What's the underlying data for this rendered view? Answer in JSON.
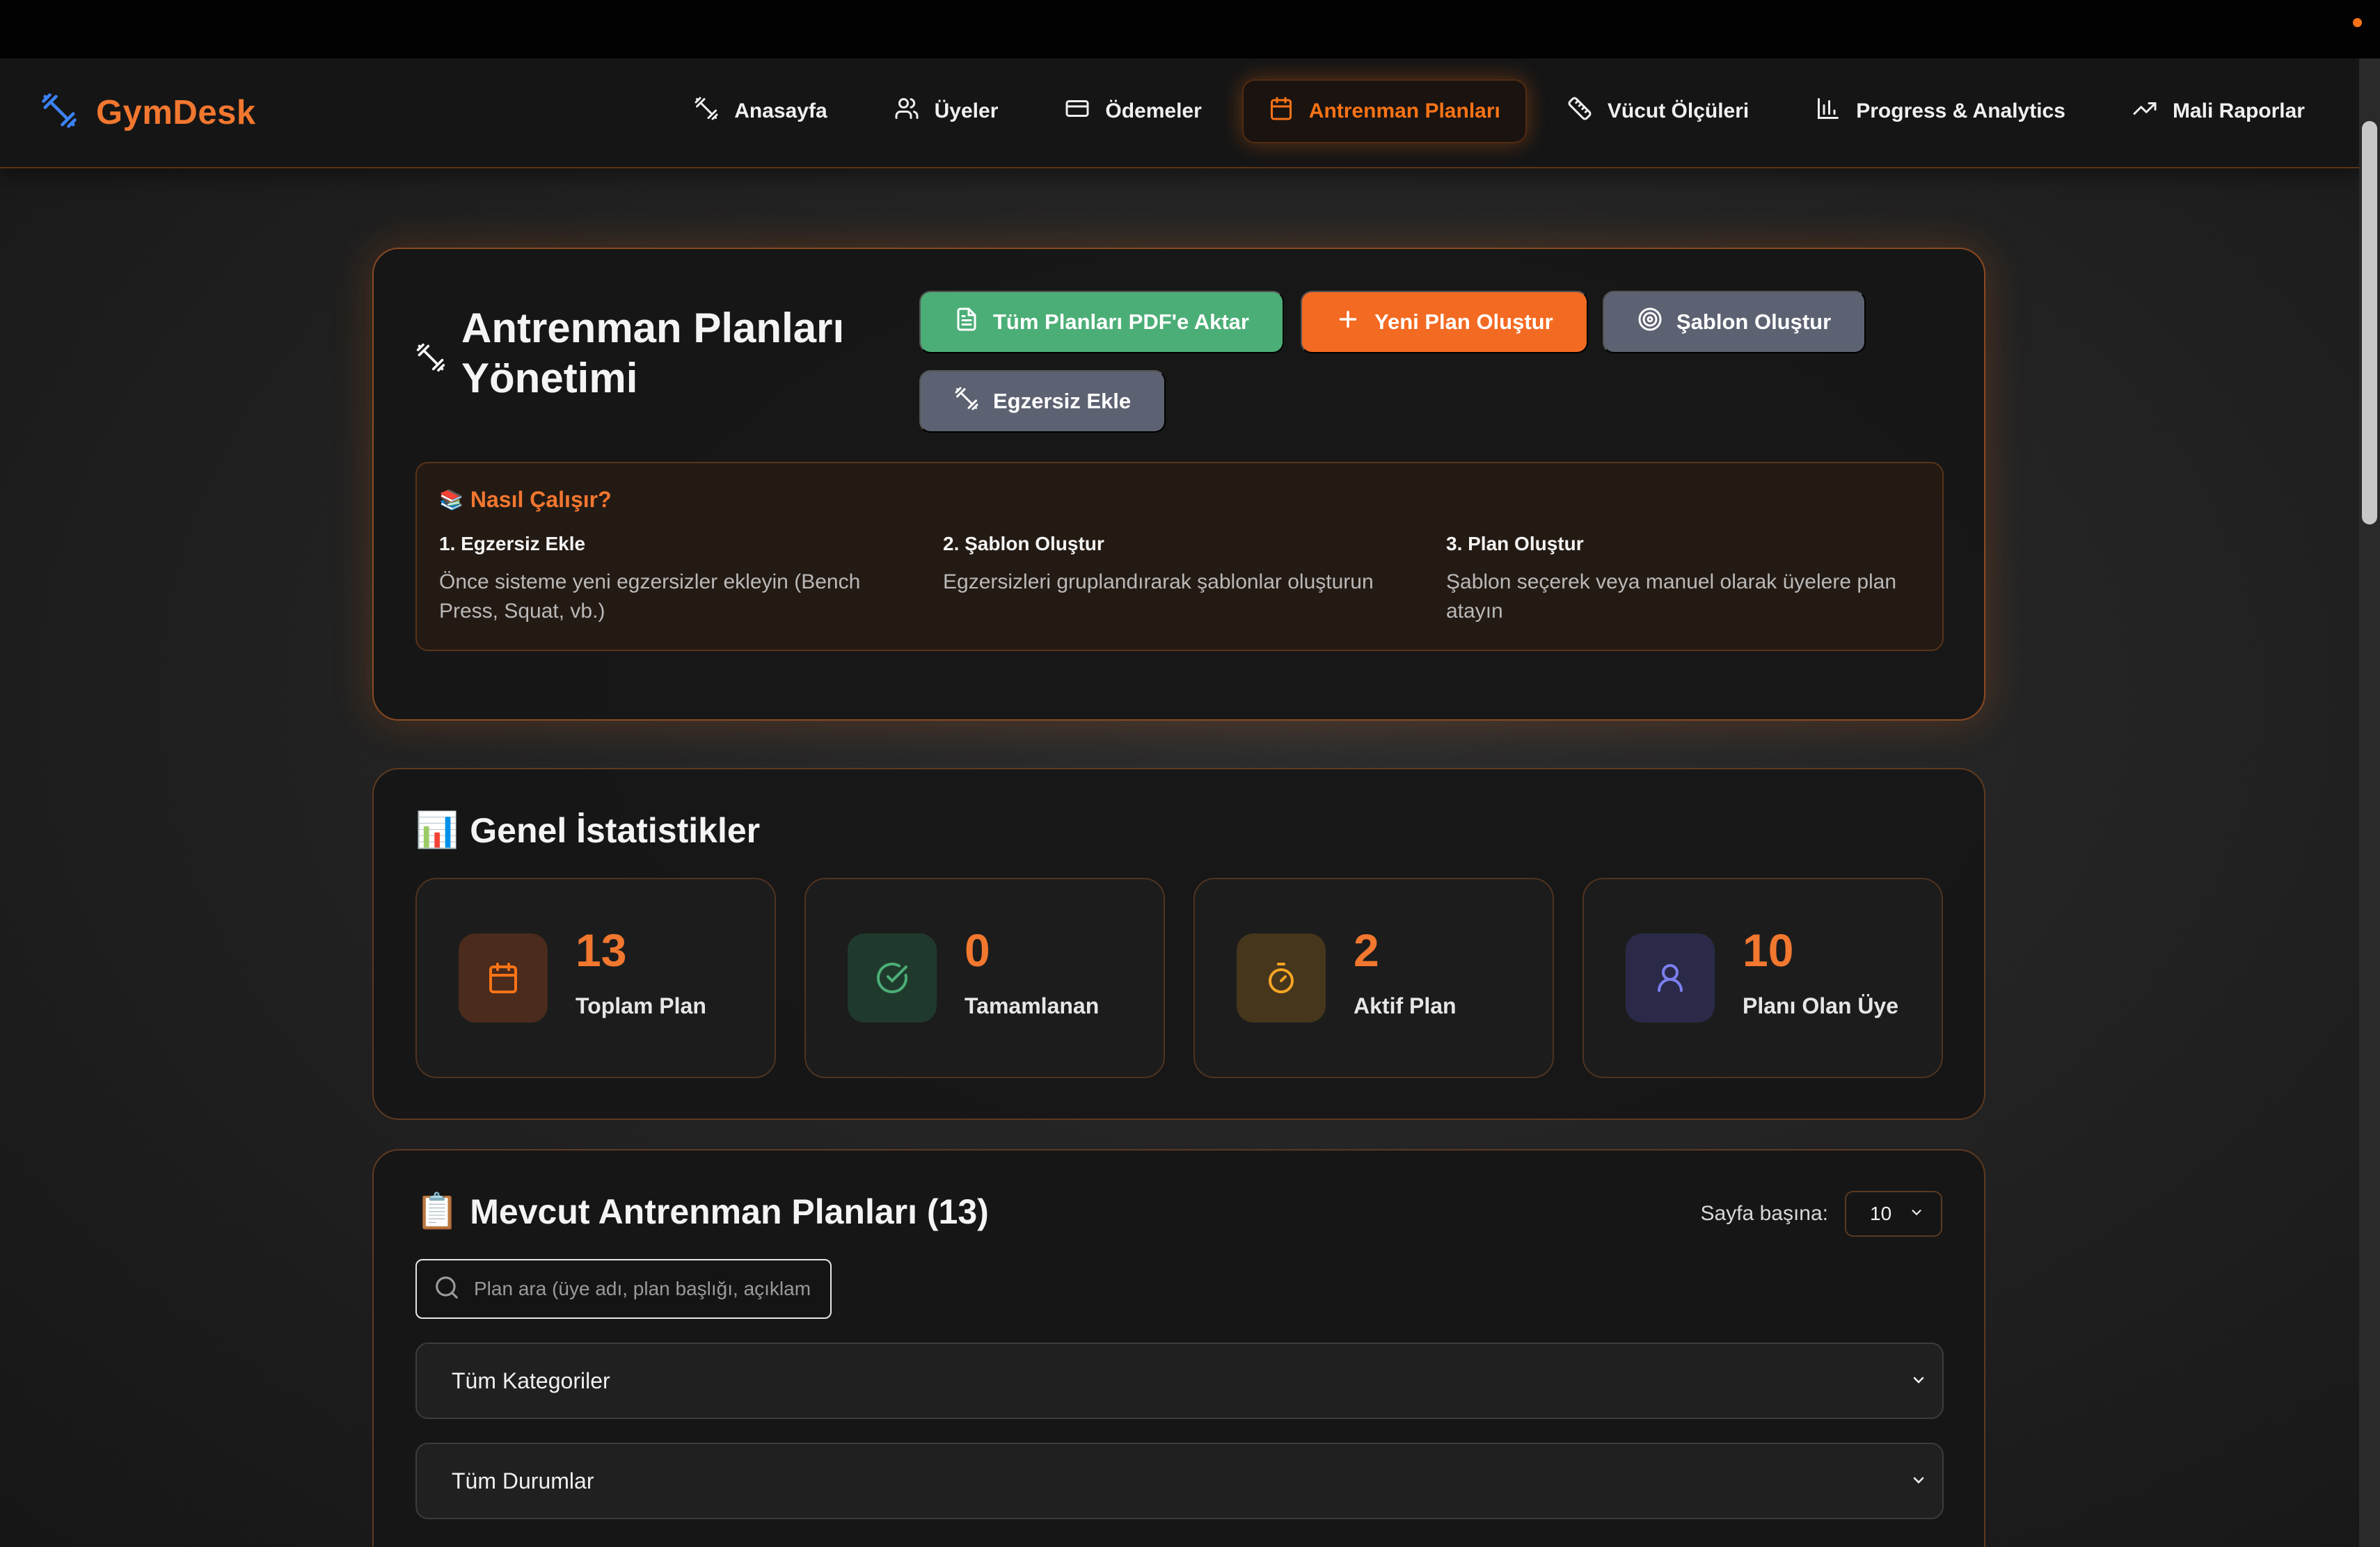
{
  "app": {
    "name": "GymDesk"
  },
  "nav": {
    "items": [
      {
        "label": "Anasayfa",
        "icon": "dumbbell-icon"
      },
      {
        "label": "Üyeler",
        "icon": "users-icon"
      },
      {
        "label": "Ödemeler",
        "icon": "credit-card-icon"
      },
      {
        "label": "Antrenman Planları",
        "icon": "calendar-icon",
        "active": true
      },
      {
        "label": "Vücut Ölçüleri",
        "icon": "ruler-icon"
      },
      {
        "label": "Progress & Analytics",
        "icon": "bar-chart-icon"
      },
      {
        "label": "Mali Raporlar",
        "icon": "trending-up-icon"
      }
    ]
  },
  "hero": {
    "title": "Antrenman Planları Yönetimi",
    "buttons": {
      "export_pdf": "Tüm Planları PDF'e Aktar",
      "new_plan": "Yeni Plan Oluştur",
      "create_template": "Şablon Oluştur",
      "add_exercise": "Egzersiz Ekle"
    },
    "howto": {
      "title": "Nasıl Çalışır?",
      "steps": [
        {
          "title": "1. Egzersiz Ekle",
          "desc": "Önce sisteme yeni egzersizler ekleyin (Bench Press, Squat, vb.)"
        },
        {
          "title": "2. Şablon Oluştur",
          "desc": "Egzersizleri gruplandırarak şablonlar oluşturun"
        },
        {
          "title": "3. Plan Oluştur",
          "desc": "Şablon seçerek veya manuel olarak üyelere plan atayın"
        }
      ]
    }
  },
  "stats": {
    "title": "Genel İstatistikler",
    "cards": [
      {
        "value": "13",
        "label": "Toplam Plan",
        "icon": "calendar-icon",
        "color": "#f97316"
      },
      {
        "value": "0",
        "label": "Tamamlanan",
        "icon": "check-circle-icon",
        "color": "#4cae77"
      },
      {
        "value": "2",
        "label": "Aktif Plan",
        "icon": "timer-icon",
        "color": "#f5a524"
      },
      {
        "value": "10",
        "label": "Planı Olan Üye",
        "icon": "user-icon",
        "color": "#7b7ff0"
      }
    ]
  },
  "plans": {
    "title": "Mevcut Antrenman Planları (13)",
    "per_page_label": "Sayfa başına:",
    "per_page_value": "10",
    "search_placeholder": "Plan ara (üye adı, plan başlığı, açıklam",
    "category_filter": "Tüm Kategoriler",
    "status_filter": "Tüm Durumlar"
  },
  "colors": {
    "accent": "#f97316",
    "green": "#4cae77",
    "gray": "#5d6272",
    "background": "#1f1f1f"
  }
}
